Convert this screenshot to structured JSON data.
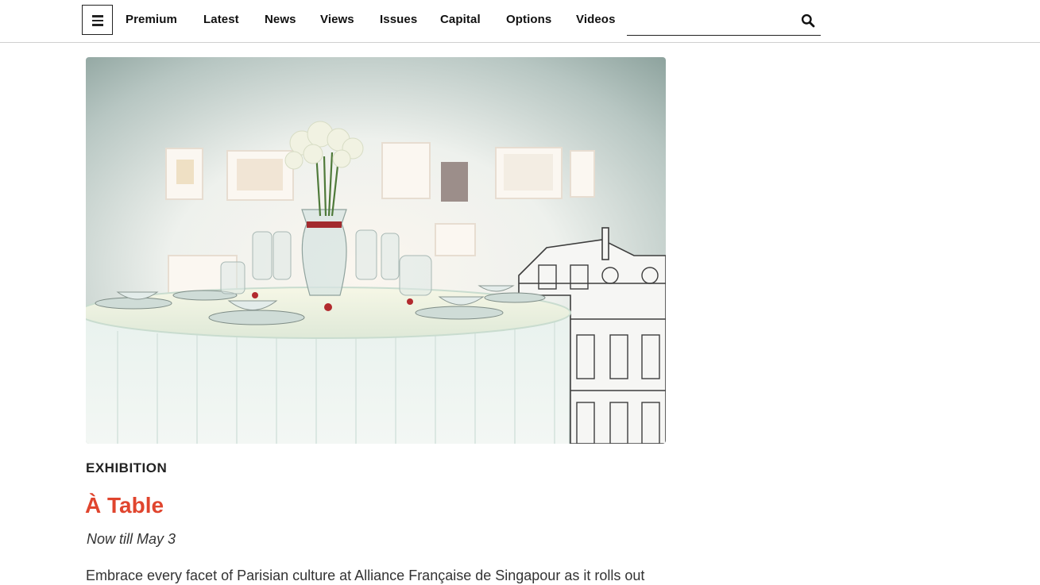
{
  "header": {
    "menu_icon": "hamburger-menu-icon",
    "nav": [
      {
        "label": "Premium"
      },
      {
        "label": "Latest"
      },
      {
        "label": "News"
      },
      {
        "label": "Views"
      },
      {
        "label": "Issues"
      },
      {
        "label": "Capital"
      },
      {
        "label": "Options"
      },
      {
        "label": "Videos"
      }
    ],
    "search": {
      "value": "",
      "placeholder": "",
      "icon": "search-icon"
    }
  },
  "article": {
    "image_alt": "Dining table set with glassware, teacups and white roses in front of framed artworks and a Parisian building illustration",
    "kicker": "EXHIBITION",
    "title": "À Table",
    "dates": "Now till May 3",
    "body": "Embrace every facet of Parisian culture at Alliance Française de Singapour as it rolls out"
  },
  "colors": {
    "accent": "#e0452e",
    "text": "#222222",
    "divider": "#cfcfcf"
  }
}
